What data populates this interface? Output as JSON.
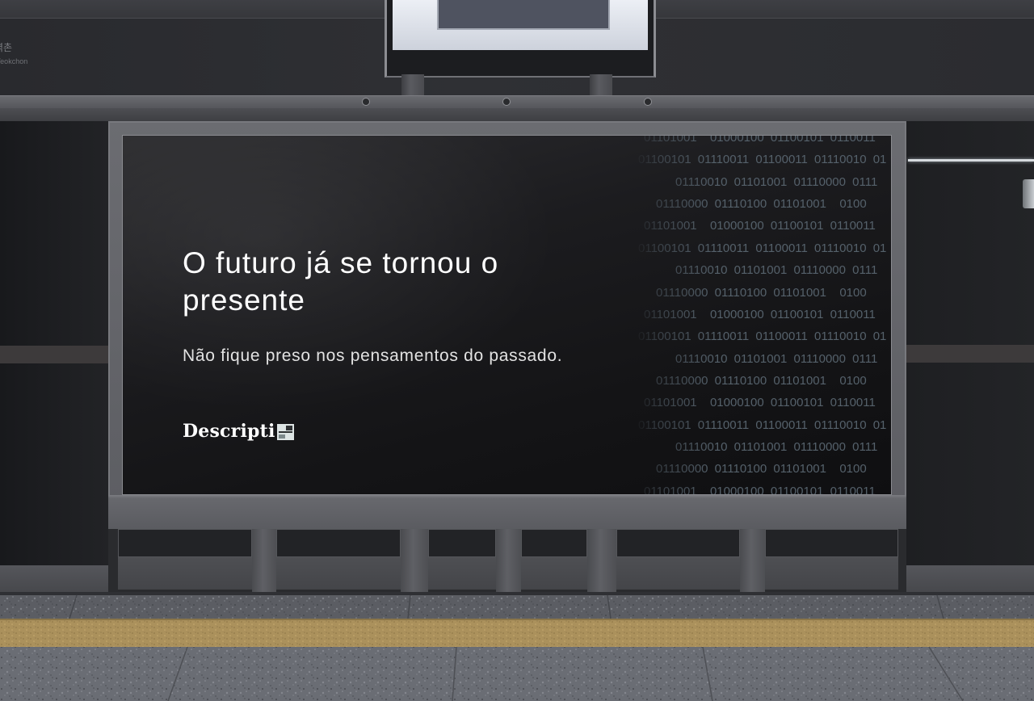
{
  "station_sign": {
    "name_ko": "역촌",
    "name_en": "Yeokchon"
  },
  "billboard": {
    "headline": "O futuro já se tornou o presente",
    "subheadline": "Não fique preso nos pensamentos do passado.",
    "brand": "Descripti",
    "brand_icon": "brand-logo-icon",
    "binary_rows": [
      "01101001  01000100 01100101 0110011",
      "01100101 01110011 01100011 01110010 01",
      "01110010 01101001 01110000 0111",
      "01110000 01110100 01101001  0100",
      "01101001  01000100 01100101 0110011",
      "01100101 01110011 01100011 01110010 01",
      "01110010 01101001 01110000 0111",
      "01110000 01110100 01101001  0100",
      "01101001  01000100 01100101 0110011",
      "01100101 01110011 01100011 01110010 01",
      "01110010 01101001 01110000 0111",
      "01110000 01110100 01101001  0100",
      "01101001  01000100 01100101 0110011",
      "01100101 01110011 01100011 01110010 01",
      "01110010 01101001 01110000 0111",
      "01110000 01110100 01101001  0100",
      "01101001  01000100 01100101 0110011"
    ]
  },
  "colors": {
    "screen_background": "#141416",
    "headline": "#ffffff",
    "binary_text": "#55616b",
    "tactile_strip": "#ab915c"
  }
}
